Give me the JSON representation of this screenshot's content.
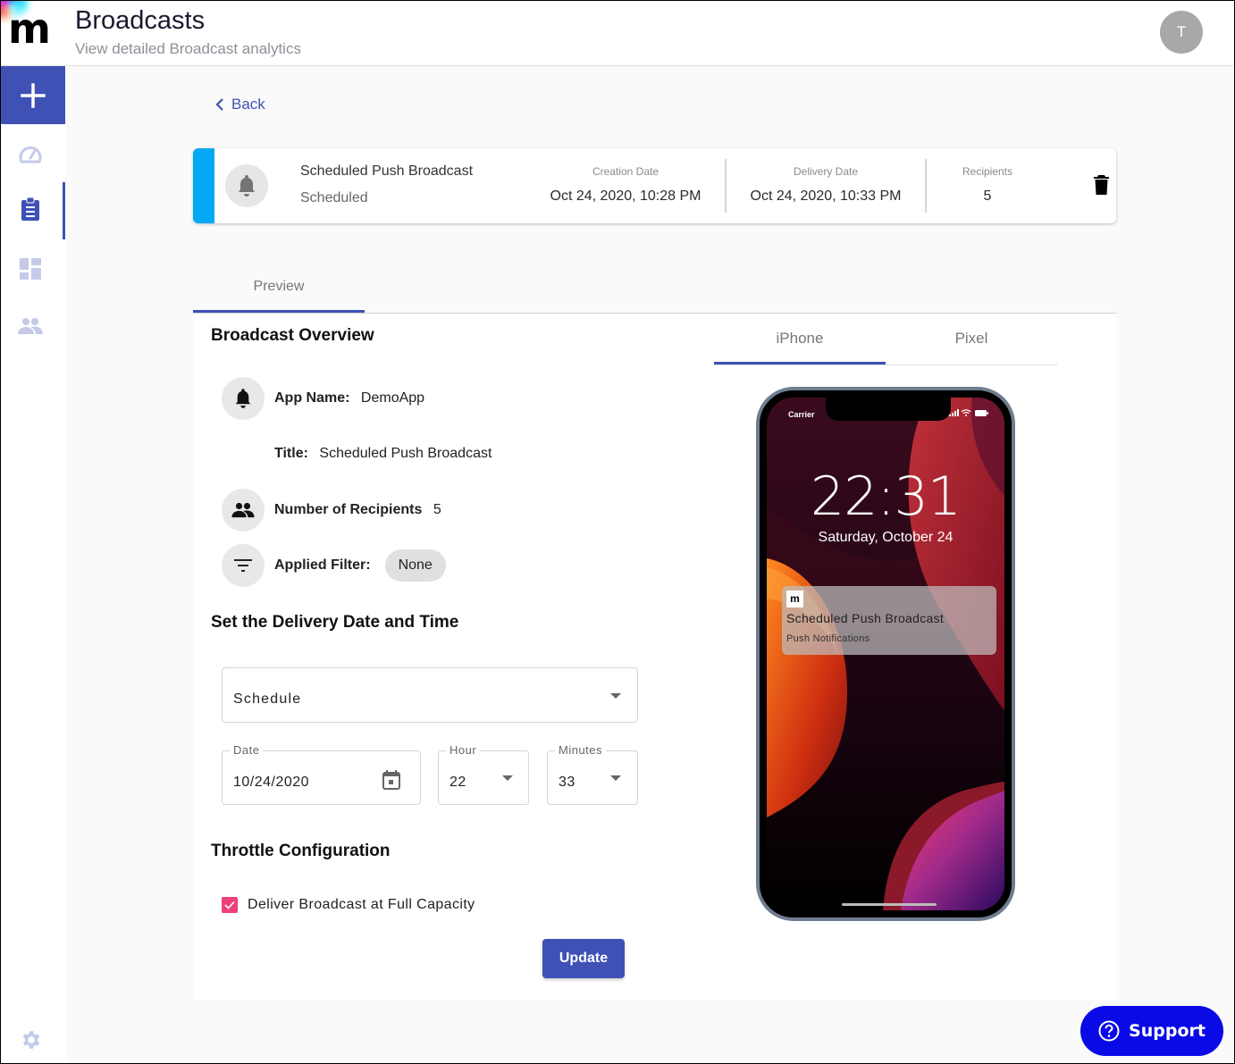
{
  "header": {
    "logo_letter": "m",
    "title": "Broadcasts",
    "subtitle": "View detailed Broadcast analytics",
    "avatar_initial": "T"
  },
  "sidebar": {
    "items": [
      {
        "name": "add",
        "icon": "plus-icon"
      },
      {
        "name": "dashboard",
        "icon": "speedometer-icon"
      },
      {
        "name": "broadcasts",
        "icon": "clipboard-icon",
        "active": true
      },
      {
        "name": "widgets",
        "icon": "dashboard-grid-icon"
      },
      {
        "name": "users",
        "icon": "people-icon"
      },
      {
        "name": "settings",
        "icon": "gear-icon"
      }
    ]
  },
  "back_label": "Back",
  "summary": {
    "name": "Scheduled Push Broadcast",
    "status": "Scheduled",
    "creation_label": "Creation Date",
    "creation_value": "Oct 24, 2020, 10:28 PM",
    "delivery_label": "Delivery Date",
    "delivery_value": "Oct 24, 2020, 10:33 PM",
    "recipients_label": "Recipients",
    "recipients_value": "5",
    "accent_color": "#03a9f4"
  },
  "tabs": [
    {
      "label": "Preview",
      "active": true
    }
  ],
  "overview": {
    "heading": "Broadcast Overview",
    "app_name_label": "App Name:",
    "app_name_value": "DemoApp",
    "title_label": "Title:",
    "title_value": "Scheduled Push Broadcast",
    "recipients_label": "Number of Recipients",
    "recipients_value": "5",
    "filter_label": "Applied Filter:",
    "filter_value": "None"
  },
  "delivery": {
    "heading": "Set the Delivery Date and Time",
    "mode_value": "Schedule",
    "date_label": "Date",
    "date_value": "10/24/2020",
    "hour_label": "Hour",
    "hour_value": "22",
    "minutes_label": "Minutes",
    "minutes_value": "33"
  },
  "throttle": {
    "heading": "Throttle Configuration",
    "checkbox_label": "Deliver Broadcast at Full Capacity",
    "checked": true
  },
  "update_label": "Update",
  "device_tabs": [
    {
      "label": "iPhone",
      "active": true
    },
    {
      "label": "Pixel",
      "active": false
    }
  ],
  "phone": {
    "carrier": "Carrier",
    "time": "22:31",
    "date": "Saturday, October 24",
    "notification": {
      "app_icon_letter": "m",
      "title": "Scheduled Push Broadcast",
      "body": "Push Notifications"
    }
  },
  "support_label": "Support",
  "colors": {
    "primary": "#3f51b5",
    "checkbox": "#ec407a",
    "support": "#0a0ae6"
  }
}
